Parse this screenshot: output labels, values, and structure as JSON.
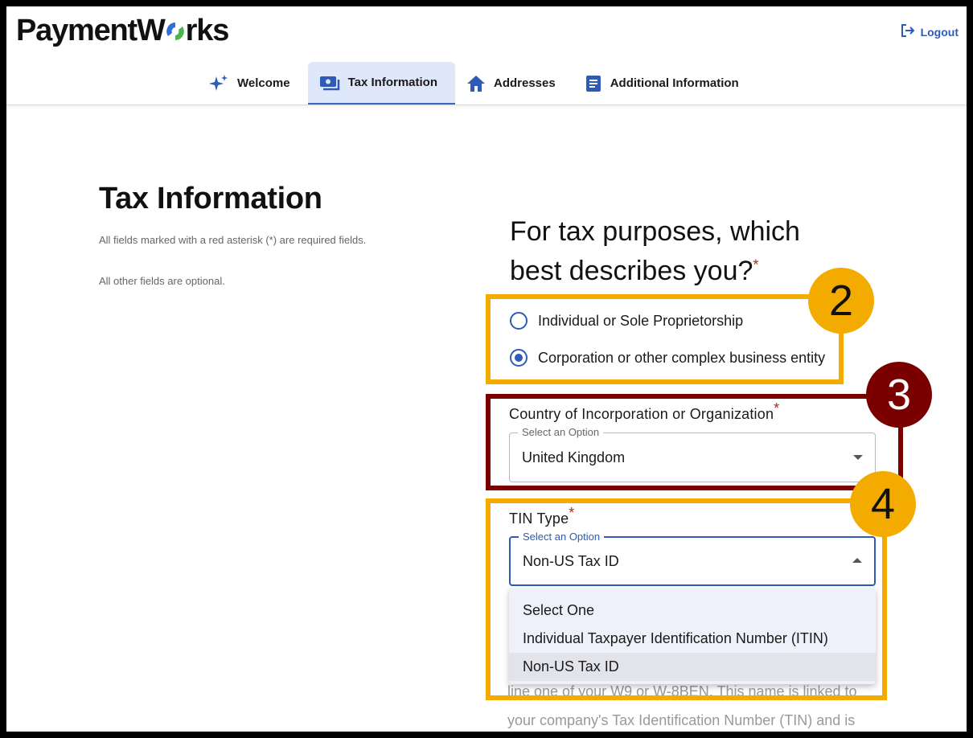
{
  "app": {
    "logo_text_left": "PaymentW",
    "logo_text_right": "rks",
    "logout_label": "Logout"
  },
  "tabs": [
    {
      "label": "Welcome",
      "icon": "sparkle-icon"
    },
    {
      "label": "Tax Information",
      "icon": "money-icon",
      "active": true
    },
    {
      "label": "Addresses",
      "icon": "home-icon"
    },
    {
      "label": "Additional Information",
      "icon": "document-icon"
    }
  ],
  "page": {
    "title": "Tax Information",
    "note_required": "All fields marked with a red asterisk (*) are required fields.",
    "note_optional": "All other fields are optional."
  },
  "form": {
    "question": "For tax purposes, which best describes you?",
    "asterisk": "*",
    "options": [
      {
        "label": "Individual or Sole Proprietorship",
        "checked": false
      },
      {
        "label": "Corporation or other complex business entity",
        "checked": true
      }
    ],
    "country": {
      "label": "Country of Incorporation or Organization",
      "legend": "Select an Option",
      "value": "United Kingdom"
    },
    "tin": {
      "label": "TIN Type",
      "legend": "Select an Option",
      "value": "Non-US Tax ID",
      "dropdown_options": [
        "Select One",
        "Individual Taxpayer Identification Number (ITIN)",
        "Non-US Tax ID"
      ]
    },
    "background_text": "line one of your W9 or W-8BEN. This name is linked to your company's Tax Identification Number (TIN) and is"
  },
  "annotations": {
    "badge_2": "2",
    "badge_3": "3",
    "badge_4": "4",
    "colors": {
      "yellow": "#f4ab00",
      "red": "#7a0000"
    }
  }
}
